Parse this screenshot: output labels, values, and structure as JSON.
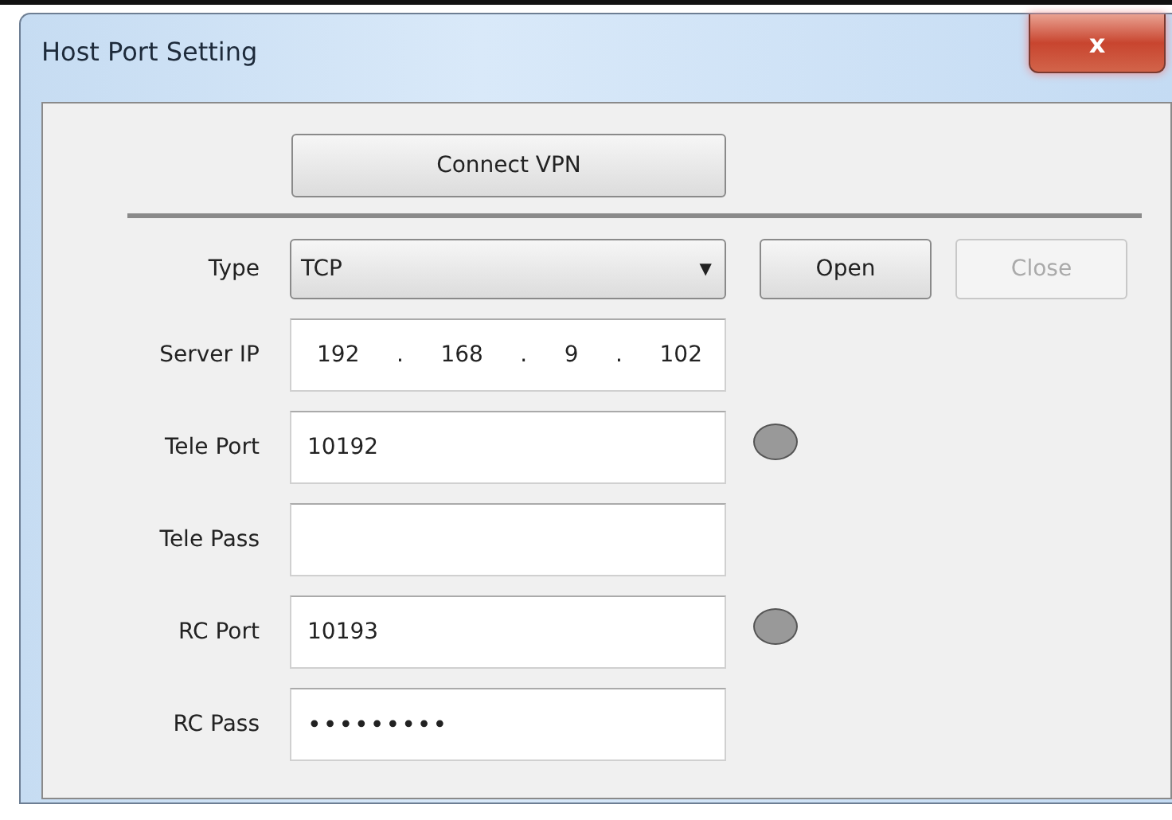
{
  "window": {
    "title": "Host Port Setting",
    "close_glyph": "x"
  },
  "connect_button": {
    "label": "Connect VPN"
  },
  "rows": [
    {
      "kind": "select",
      "label": "Type",
      "value": "TCP",
      "arrow": "▼",
      "buttons": [
        {
          "label": "Open",
          "disabled": false
        },
        {
          "label": "Close",
          "disabled": true
        }
      ]
    },
    {
      "kind": "ip",
      "label": "Server IP",
      "octets": [
        "192",
        "168",
        "9",
        "102"
      ],
      "separator": "."
    },
    {
      "kind": "text",
      "label": "Tele Port",
      "value": "10192",
      "indicator": {
        "color": "#999999"
      }
    },
    {
      "kind": "text",
      "label": "Tele Pass"
    },
    {
      "kind": "text",
      "label": "RC Port",
      "value": "10193",
      "indicator": {
        "color": "#999999"
      }
    },
    {
      "kind": "text",
      "label": "RC Pass",
      "value": "•••••••••"
    }
  ]
}
